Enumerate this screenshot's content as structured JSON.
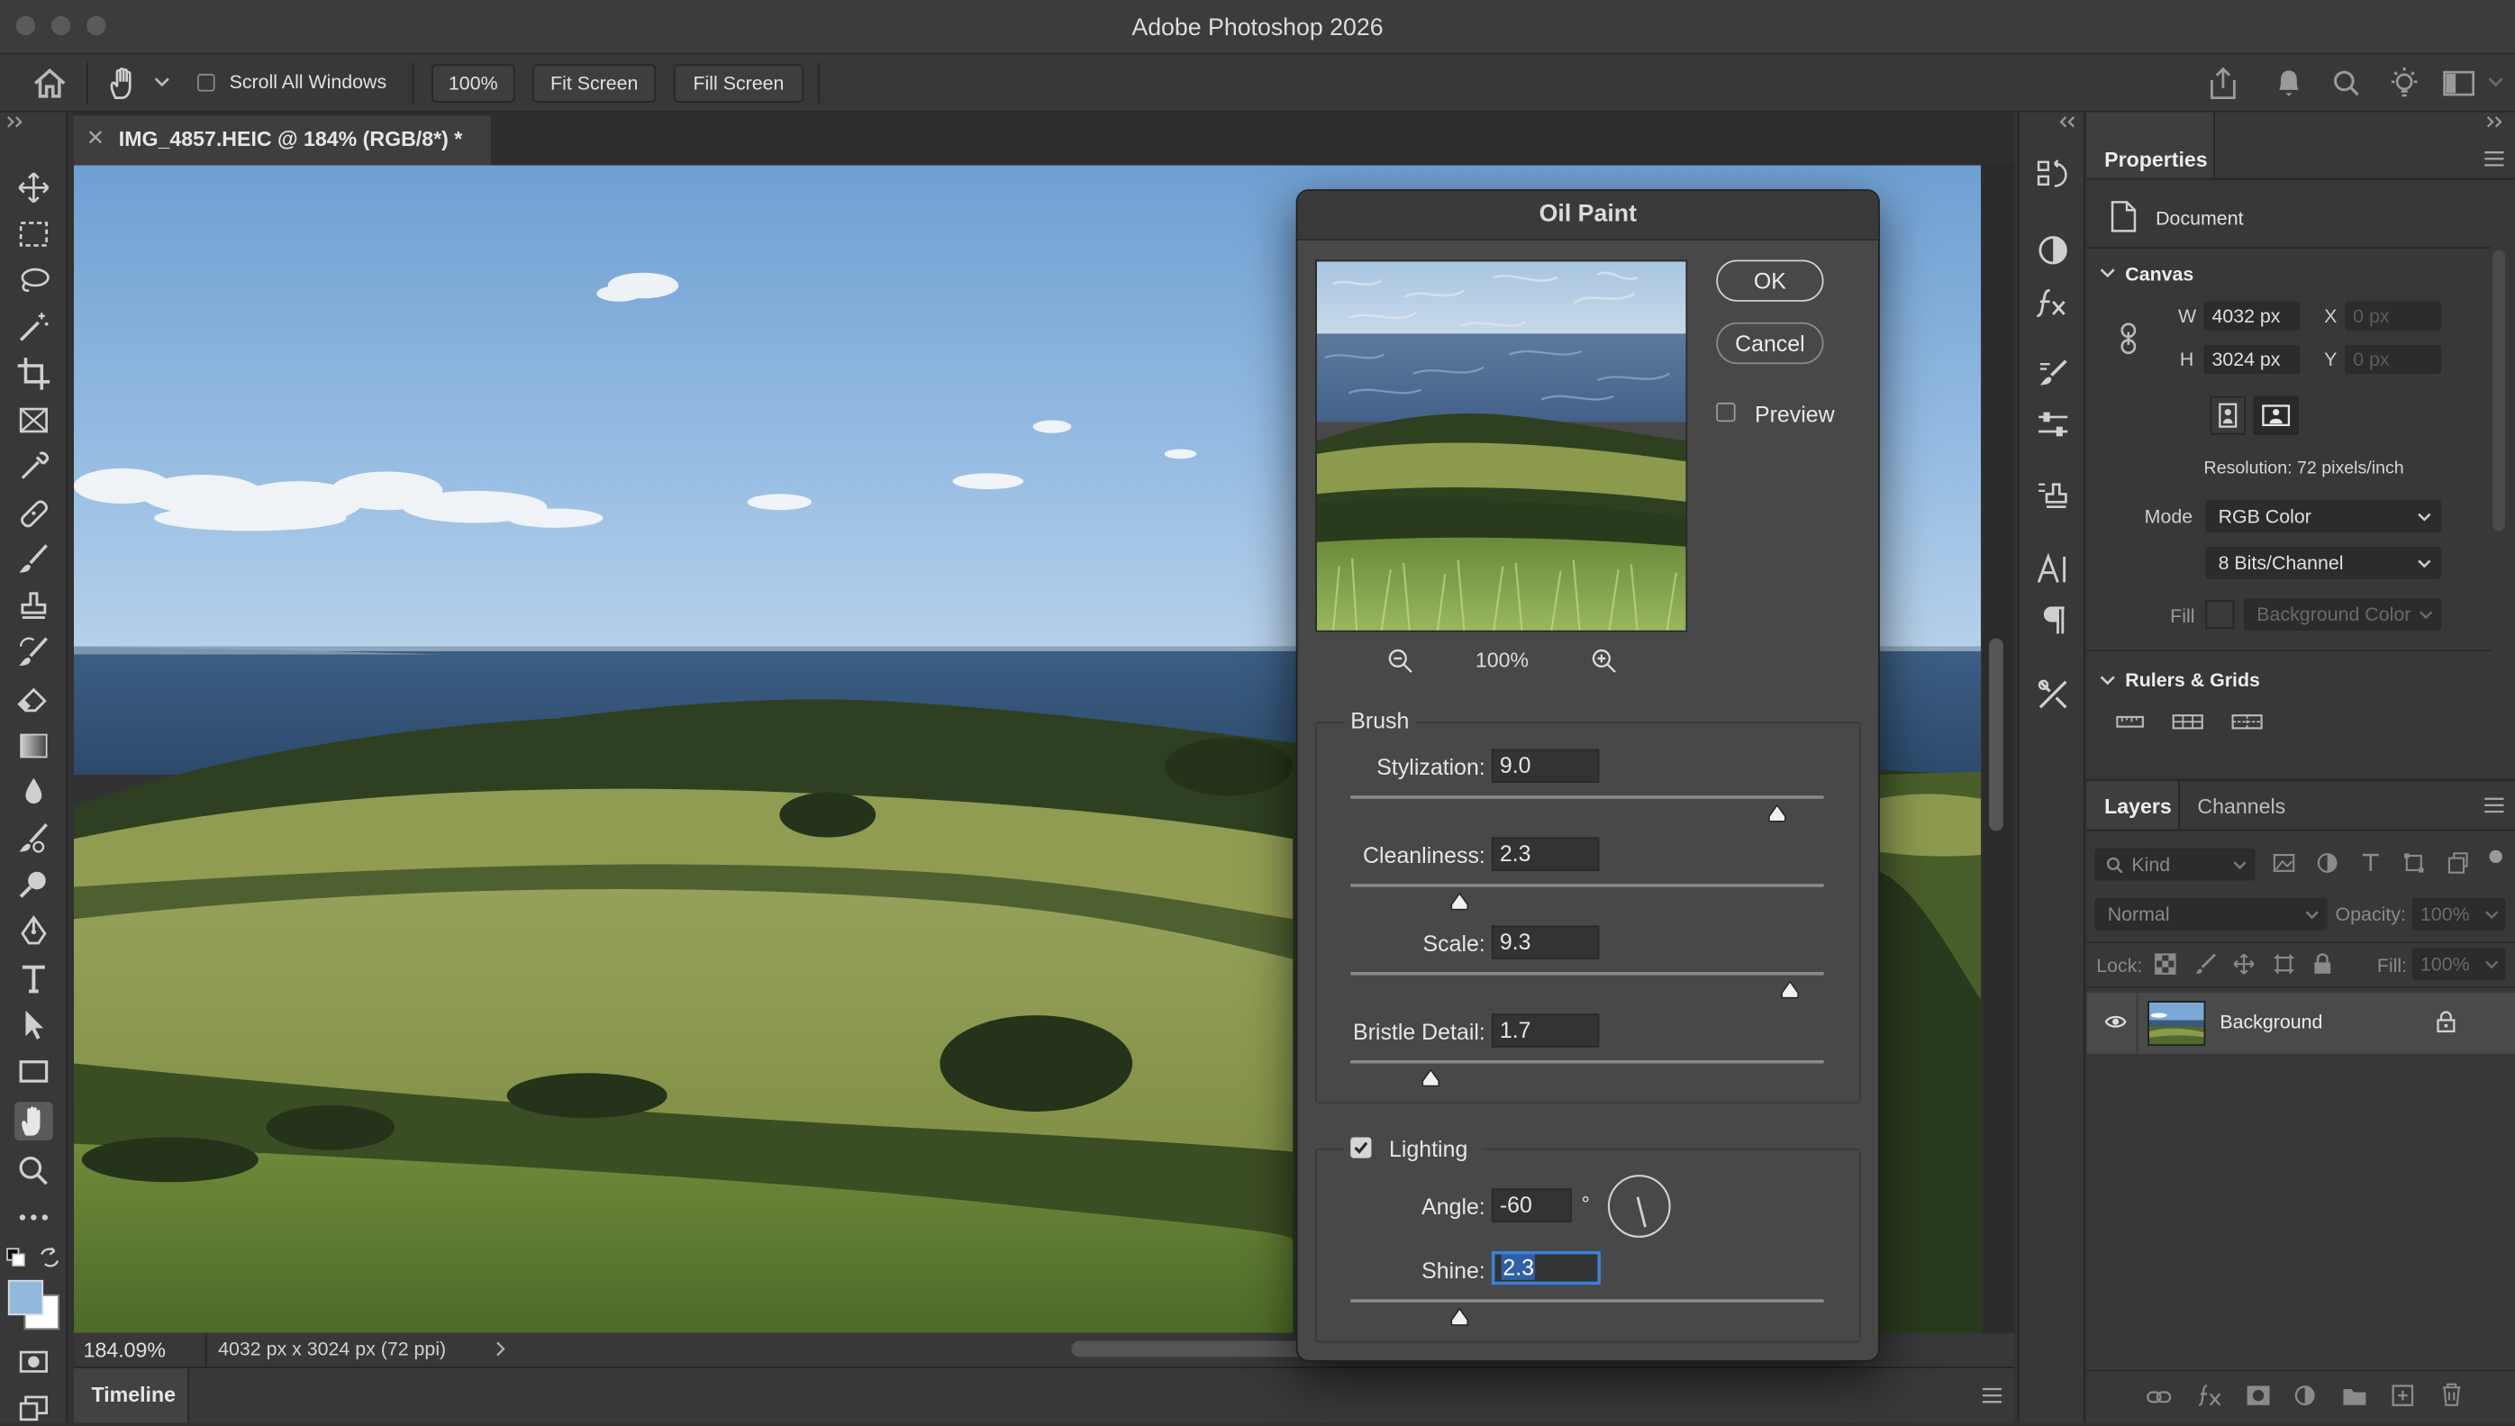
{
  "app": {
    "title": "Adobe Photoshop 2026"
  },
  "options_bar": {
    "scroll_all_windows_label": "Scroll All Windows",
    "scroll_all_windows_checked": false,
    "zoom_100_label": "100%",
    "fit_screen_label": "Fit Screen",
    "fill_screen_label": "Fill Screen"
  },
  "document": {
    "tab_title": "IMG_4857.HEIC @ 184% (RGB/8*) *",
    "zoom_status": "184.09%",
    "size_status": "4032 px x 3024 px (72 ppi)"
  },
  "timeline": {
    "label": "Timeline"
  },
  "dialog": {
    "title": "Oil Paint",
    "ok_label": "OK",
    "cancel_label": "Cancel",
    "preview_label": "Preview",
    "preview_checked": false,
    "preview_zoom": "100%",
    "brush": {
      "label": "Brush",
      "params": [
        {
          "label": "Stylization:",
          "value": "9.0",
          "fraction": 0.9
        },
        {
          "label": "Cleanliness:",
          "value": "2.3",
          "fraction": 0.23
        },
        {
          "label": "Scale:",
          "value": "9.3",
          "fraction": 0.93
        },
        {
          "label": "Bristle Detail:",
          "value": "1.7",
          "fraction": 0.17
        }
      ]
    },
    "lighting": {
      "label": "Lighting",
      "checked": true,
      "angle_label": "Angle:",
      "angle_value": "-60",
      "degree_symbol": "°",
      "angle_degrees": -60,
      "shine_label": "Shine:",
      "shine_value": "2.3",
      "shine_fraction": 0.23
    }
  },
  "properties": {
    "tab_label": "Properties",
    "document_label": "Document",
    "canvas_section": "Canvas",
    "w_label": "W",
    "w_value": "4032 px",
    "h_label": "H",
    "h_value": "3024 px",
    "x_label": "X",
    "x_value": "0 px",
    "y_label": "Y",
    "y_value": "0 px",
    "resolution_text": "Resolution: 72 pixels/inch",
    "mode_label": "Mode",
    "mode_value": "RGB Color",
    "bits_value": "8 Bits/Channel",
    "fill_label": "Fill",
    "fill_value": "Background Color",
    "rulers_section": "Rulers & Grids"
  },
  "layers_panel": {
    "tab_layers": "Layers",
    "tab_channels": "Channels",
    "filter_kind": "Kind",
    "blend_mode": "Normal",
    "opacity_label": "Opacity:",
    "opacity_value": "100%",
    "lock_label": "Lock:",
    "fill_label": "Fill:",
    "fill_value": "100%",
    "layers": [
      {
        "name": "Background",
        "visible": true,
        "locked": true
      }
    ]
  },
  "colors": {
    "accent": "#3a82d6",
    "selection_highlight": "#2f5fa8"
  }
}
